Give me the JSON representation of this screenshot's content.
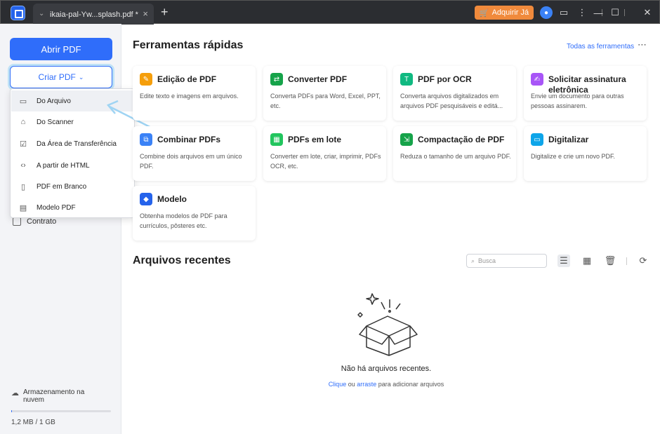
{
  "titlebar": {
    "tab_label": "ikaia-pal-Yw...splash.pdf *",
    "tab_close": "×",
    "new_tab": "+",
    "buy_label": "Adquirir Já",
    "buy_icon": "🛒"
  },
  "sidebar": {
    "open_label": "Abrir PDF",
    "create_label": "Criar PDF",
    "contract_label": "Contrato",
    "cloud_label": "Armazenamento na nuvem",
    "storage_text": "1,2 MB / 1 GB",
    "storage_fraction": 0.0012
  },
  "dropdown": {
    "items": [
      {
        "label": "Do Arquivo",
        "icon": "folder-icon"
      },
      {
        "label": "Do Scanner",
        "icon": "scanner-icon"
      },
      {
        "label": "Da Área de Transferência",
        "icon": "clipboard-icon"
      },
      {
        "label": "A partir de HTML",
        "icon": "html-icon"
      },
      {
        "label": "PDF em Branco",
        "icon": "blank-page-icon"
      },
      {
        "label": "Modelo PDF",
        "icon": "template-icon"
      }
    ]
  },
  "main": {
    "quick_title": "Ferramentas rápidas",
    "all_tools": "Todas as ferramentas",
    "tools": [
      {
        "title": "Edição de PDF",
        "desc": "Edite texto e imagens em arquivos.",
        "color": "#f59e0b"
      },
      {
        "title": "Converter PDF",
        "desc": "Converta PDFs para Word, Excel, PPT, etc.",
        "color": "#16a34a"
      },
      {
        "title": "PDF por OCR",
        "desc": "Converta arquivos digitalizados em arquivos PDF pesquisáveis e editá...",
        "color": "#10b981"
      },
      {
        "title": "Solicitar assinatura eletrônica",
        "desc": "Envie um documento para outras pessoas assinarem.",
        "color": "#a855f7"
      },
      {
        "title": "Combinar PDFs",
        "desc": "Combine dois arquivos em um único PDF.",
        "color": "#3b82f6"
      },
      {
        "title": "PDFs em lote",
        "desc": "Converter em lote, criar, imprimir, PDFs OCR, etc.",
        "color": "#22c55e"
      },
      {
        "title": "Compactação de PDF",
        "desc": "Reduza o tamanho de um arquivo PDF.",
        "color": "#16a34a"
      },
      {
        "title": "Digitalizar",
        "desc": "Digitalize e crie um novo PDF.",
        "color": "#0ea5e9"
      },
      {
        "title": "Modelo",
        "desc": "Obtenha modelos de PDF para currículos, pôsteres etc.",
        "color": "#2563eb"
      }
    ],
    "recent_title": "Arquivos recentes",
    "search_placeholder": "Busca",
    "empty_title": "Não há arquivos recentes.",
    "empty_link1": "Clique",
    "empty_mid": " ou ",
    "empty_link2": "arraste",
    "empty_tail": " para adicionar arquivos"
  }
}
